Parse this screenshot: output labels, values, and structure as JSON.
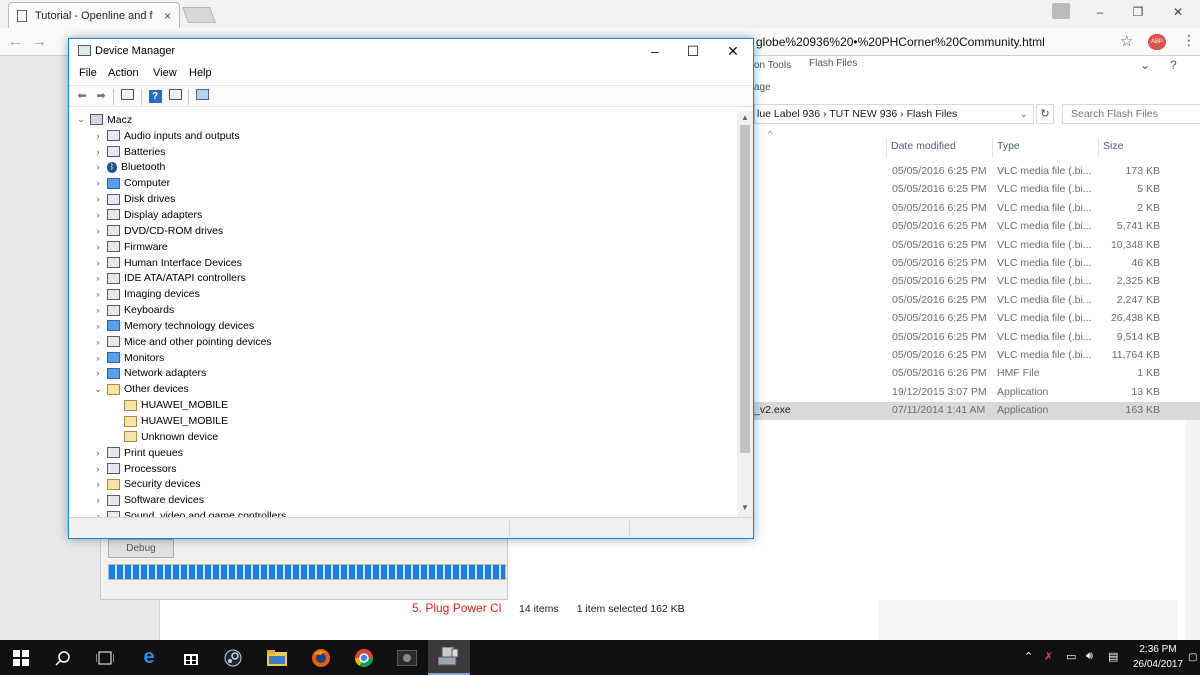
{
  "browser": {
    "tab_title": "Tutorial - Openline and f",
    "tab_close": "×",
    "url_visible": "globe%20936%20•%20PHCorner%20Community.html",
    "ext_badge": "ABP",
    "minimize": "–",
    "restore": "❐",
    "close": "✕"
  },
  "device_manager": {
    "title": "Device Manager",
    "menu": [
      "File",
      "Action",
      "View",
      "Help"
    ],
    "window_controls": {
      "minimize": "–",
      "maximize": "☐",
      "close": "✕"
    },
    "root": "Macz",
    "tree": [
      {
        "label": "Audio inputs and outputs",
        "chevron": "›",
        "level": 1,
        "icon": "speaker-icon"
      },
      {
        "label": "Batteries",
        "chevron": "›",
        "level": 1,
        "icon": "battery-icon"
      },
      {
        "label": "Bluetooth",
        "chevron": "›",
        "level": 1,
        "icon": "bluetooth-icon"
      },
      {
        "label": "Computer",
        "chevron": "›",
        "level": 1,
        "icon": "computer-icon"
      },
      {
        "label": "Disk drives",
        "chevron": "›",
        "level": 1,
        "icon": "disk-drive-icon"
      },
      {
        "label": "Display adapters",
        "chevron": "›",
        "level": 1,
        "icon": "display-adapter-icon"
      },
      {
        "label": "DVD/CD-ROM drives",
        "chevron": "›",
        "level": 1,
        "icon": "dvd-icon"
      },
      {
        "label": "Firmware",
        "chevron": "›",
        "level": 1,
        "icon": "firmware-icon"
      },
      {
        "label": "Human Interface Devices",
        "chevron": "›",
        "level": 1,
        "icon": "hid-icon"
      },
      {
        "label": "IDE ATA/ATAPI controllers",
        "chevron": "›",
        "level": 1,
        "icon": "ide-controller-icon"
      },
      {
        "label": "Imaging devices",
        "chevron": "›",
        "level": 1,
        "icon": "camera-icon"
      },
      {
        "label": "Keyboards",
        "chevron": "›",
        "level": 1,
        "icon": "keyboard-icon"
      },
      {
        "label": "Memory technology devices",
        "chevron": "›",
        "level": 1,
        "icon": "memory-icon"
      },
      {
        "label": "Mice and other pointing devices",
        "chevron": "›",
        "level": 1,
        "icon": "mouse-icon"
      },
      {
        "label": "Monitors",
        "chevron": "›",
        "level": 1,
        "icon": "monitor-icon"
      },
      {
        "label": "Network adapters",
        "chevron": "›",
        "level": 1,
        "icon": "network-adapter-icon"
      },
      {
        "label": "Other devices",
        "chevron": "⌄",
        "level": 1,
        "icon": "other-devices-icon"
      },
      {
        "label": "HUAWEI_MOBILE",
        "chevron": "",
        "level": 2,
        "icon": "unknown-device-warning-icon"
      },
      {
        "label": "HUAWEI_MOBILE",
        "chevron": "",
        "level": 2,
        "icon": "unknown-device-warning-icon"
      },
      {
        "label": "Unknown device",
        "chevron": "",
        "level": 2,
        "icon": "unknown-device-warning-icon"
      },
      {
        "label": "Print queues",
        "chevron": "›",
        "level": 1,
        "icon": "printer-icon"
      },
      {
        "label": "Processors",
        "chevron": "›",
        "level": 1,
        "icon": "processor-icon"
      },
      {
        "label": "Security devices",
        "chevron": "›",
        "level": 1,
        "icon": "security-device-icon"
      },
      {
        "label": "Software devices",
        "chevron": "›",
        "level": 1,
        "icon": "software-device-icon"
      },
      {
        "label": "Sound, video and game controllers",
        "chevron": "›",
        "level": 1,
        "icon": "sound-controller-icon"
      }
    ]
  },
  "file_explorer": {
    "ribbon_tabs": [
      "on Tools",
      "Flash Files"
    ],
    "ribbon_sub": "age",
    "breadcrumb": "lue Label 936  ›  TUT NEW 936  ›  Flash Files",
    "search_placeholder": "Search Flash Files",
    "columns": [
      "Date modified",
      "Type",
      "Size"
    ],
    "rows": [
      {
        "name": "",
        "date": "05/05/2016 6:25 PM",
        "type": "VLC media file (.bi...",
        "size": "173 KB"
      },
      {
        "name": "",
        "date": "05/05/2016 6:25 PM",
        "type": "VLC media file (.bi...",
        "size": "5 KB"
      },
      {
        "name": "",
        "date": "05/05/2016 6:25 PM",
        "type": "VLC media file (.bi...",
        "size": "2 KB"
      },
      {
        "name": "",
        "date": "05/05/2016 6:25 PM",
        "type": "VLC media file (.bi...",
        "size": "5,741 KB"
      },
      {
        "name": "",
        "date": "05/05/2016 6:25 PM",
        "type": "VLC media file (.bi...",
        "size": "10,348 KB"
      },
      {
        "name": "",
        "date": "05/05/2016 6:25 PM",
        "type": "VLC media file (.bi...",
        "size": "46 KB"
      },
      {
        "name": "",
        "date": "05/05/2016 6:25 PM",
        "type": "VLC media file (.bi...",
        "size": "2,325 KB"
      },
      {
        "name": "",
        "date": "05/05/2016 6:25 PM",
        "type": "VLC media file (.bi...",
        "size": "2,247 KB"
      },
      {
        "name": "",
        "date": "05/05/2016 6:25 PM",
        "type": "VLC media file (.bi...",
        "size": "26,438 KB"
      },
      {
        "name": "",
        "date": "05/05/2016 6:25 PM",
        "type": "VLC media file (.bi...",
        "size": "9,514 KB"
      },
      {
        "name": "",
        "date": "05/05/2016 6:25 PM",
        "type": "VLC media file (.bi...",
        "size": "11,764 KB"
      },
      {
        "name": "",
        "date": "05/05/2016 6:26 PM",
        "type": "HMF File",
        "size": "1 KB"
      },
      {
        "name": "",
        "date": "19/12/2015 3:07 PM",
        "type": "Application",
        "size": "13 KB"
      },
      {
        "name": "_v2.exe",
        "date": "07/11/2014 1:41 AM",
        "type": "Application",
        "size": "163 KB",
        "selected": true
      }
    ],
    "status_items": "14 items",
    "status_selected": "1 item selected  162 KB"
  },
  "flasher": {
    "debug_label": "Debug",
    "step_text": "5. Plug Power Cl",
    "progress_percent": 100
  },
  "taskbar": {
    "time": "2:36 PM",
    "date": "26/04/2017",
    "apps": [
      "start-icon",
      "search-icon",
      "task-view-icon",
      "edge-icon",
      "store-icon",
      "steam-icon",
      "file-explorer-icon",
      "firefox-icon",
      "chrome-icon",
      "app-icon",
      "device-manager-icon"
    ]
  }
}
